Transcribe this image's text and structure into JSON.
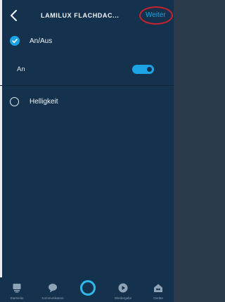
{
  "header": {
    "title": "LAMILUX FLACHDAC...",
    "back_icon": "chevron-left-icon",
    "next_label": "Weiter"
  },
  "settings": {
    "onoff": {
      "label": "An/Aus",
      "checked": true
    },
    "state": {
      "label": "An",
      "toggle_on": true
    },
    "brightness": {
      "label": "Helligkeit",
      "selected": false
    }
  },
  "bottom_nav": {
    "items": [
      {
        "label": "Startseite",
        "icon": "home-icon"
      },
      {
        "label": "Kommunikation",
        "icon": "chat-bubble-icon"
      },
      {
        "label": "",
        "icon": "alexa-ring-icon"
      },
      {
        "label": "Wiedergabe",
        "icon": "play-icon"
      },
      {
        "label": "Geräte",
        "icon": "devices-home-icon"
      }
    ]
  },
  "colors": {
    "background": "#14324d",
    "accent": "#1ca3e6",
    "highlight_ring": "#c8222d",
    "text": "#f2f5f8"
  }
}
